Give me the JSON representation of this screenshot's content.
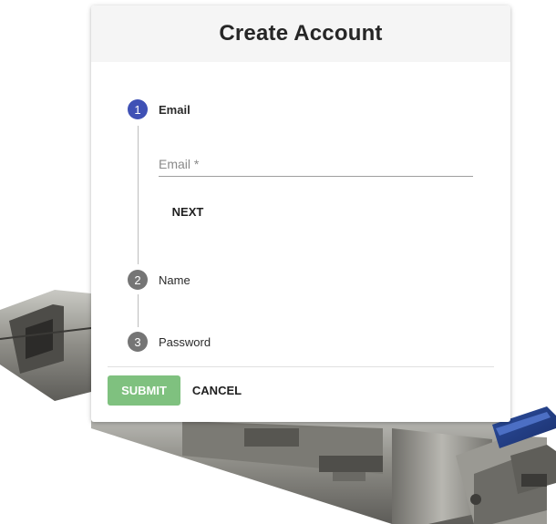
{
  "dialog": {
    "title": "Create Account"
  },
  "stepper": {
    "steps": [
      {
        "number": "1",
        "label": "Email",
        "state": "active"
      },
      {
        "number": "2",
        "label": "Name",
        "state": "inactive"
      },
      {
        "number": "3",
        "label": "Password",
        "state": "inactive"
      }
    ],
    "email_field": {
      "placeholder": "Email *",
      "value": ""
    },
    "next_label": "NEXT"
  },
  "actions": {
    "submit_label": "SUBMIT",
    "cancel_label": "CANCEL"
  },
  "colors": {
    "active_step": "#3f51b5",
    "inactive_step": "#757575",
    "submit_button": "#7fc17f",
    "header_background": "#f5f5f5"
  },
  "icons": {
    "background_image": "sfp-transceiver-module-photo"
  }
}
